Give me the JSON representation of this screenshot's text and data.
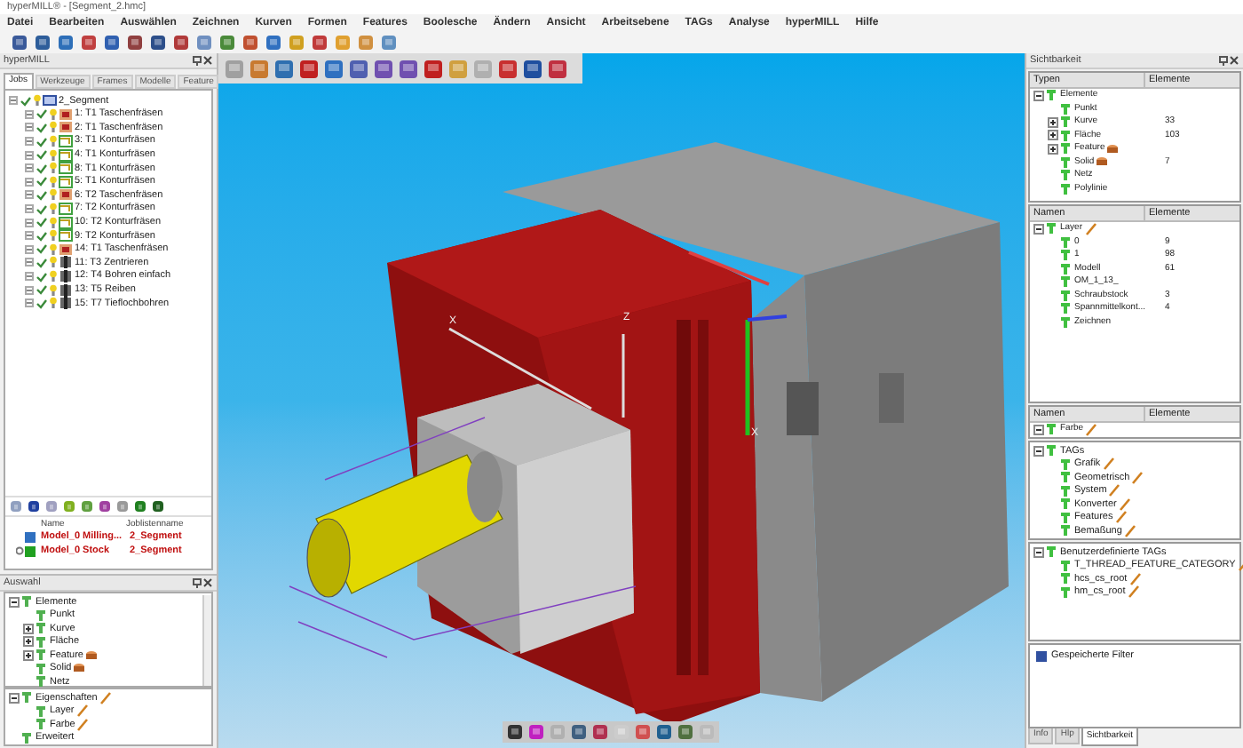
{
  "window": {
    "title": "hyperMILL® - [Segment_2.hmc]"
  },
  "menu": [
    "Datei",
    "Bearbeiten",
    "Auswählen",
    "Zeichnen",
    "Kurven",
    "Formen",
    "Features",
    "Boolesche",
    "Ändern",
    "Ansicht",
    "Arbeitsebene",
    "TAGs",
    "Analyse",
    "hyperMILL",
    "Hilfe"
  ],
  "jobs_panel": {
    "title": "hyperMILL",
    "tabs": [
      {
        "label": "Jobs",
        "selected": true
      },
      {
        "label": "Werkzeuge",
        "selected": false
      },
      {
        "label": "Frames",
        "selected": false
      },
      {
        "label": "Modelle",
        "selected": false
      },
      {
        "label": "Feature",
        "selected": false
      }
    ],
    "tree": [
      {
        "label": "2_Segment",
        "kind": "folder",
        "checked": true,
        "children": [
          {
            "label": "1: T1 Taschenfräsen",
            "kind": "pocket",
            "checked": true
          },
          {
            "label": "2: T1 Taschenfräsen",
            "kind": "pocket",
            "checked": true
          },
          {
            "label": "3: T1 Konturfräsen",
            "kind": "contour",
            "checked": true
          },
          {
            "label": "4: T1 Konturfräsen",
            "kind": "contour",
            "checked": true
          },
          {
            "label": "8: T1 Konturfräsen",
            "kind": "contour",
            "checked": true
          },
          {
            "label": "5: T1 Konturfräsen",
            "kind": "contour",
            "checked": true
          },
          {
            "label": "6: T2 Taschenfräsen",
            "kind": "pocket",
            "checked": true
          },
          {
            "label": "7: T2 Konturfräsen",
            "kind": "contour",
            "checked": true
          },
          {
            "label": "10: T2 Konturfräsen",
            "kind": "contour",
            "checked": true
          },
          {
            "label": "9: T2 Konturfräsen",
            "kind": "contour",
            "checked": true
          },
          {
            "label": "14: T1 Taschenfräsen",
            "kind": "pocket",
            "checked": true
          },
          {
            "label": "11: T3 Zentrieren",
            "kind": "drill",
            "checked": true
          },
          {
            "label": "12: T4 Bohren einfach",
            "kind": "drill",
            "checked": true
          },
          {
            "label": "13: T5 Reiben",
            "kind": "drill",
            "checked": true
          },
          {
            "label": "15: T7 Tieflochbohren",
            "kind": "drill",
            "checked": true
          }
        ]
      }
    ],
    "model_table": {
      "columns": [
        "Name",
        "Joblistenname"
      ],
      "rows": [
        {
          "kind": "milling",
          "name": "Model_0 Milling...",
          "joblist": "2_Segment"
        },
        {
          "kind": "stock",
          "name": "Model_0 Stock",
          "joblist": "2_Segment"
        }
      ]
    }
  },
  "selection_panel": {
    "title": "Auswahl",
    "tree": [
      {
        "label": "Elemente",
        "kind": "plain",
        "expanded": true,
        "children": [
          {
            "label": "Punkt",
            "kind": "plain"
          },
          {
            "label": "Kurve",
            "kind": "plain",
            "expanded": false
          },
          {
            "label": "Fläche",
            "kind": "plain",
            "expanded": false
          },
          {
            "label": "Feature",
            "kind": "solid",
            "expanded": false
          },
          {
            "label": "Solid",
            "kind": "solid"
          },
          {
            "label": "Netz",
            "kind": "plain"
          }
        ]
      }
    ],
    "properties": [
      {
        "label": "Eigenschaften",
        "kind": "tagged",
        "expanded": true,
        "children": [
          {
            "label": "Layer",
            "kind": "tagged"
          },
          {
            "label": "Farbe",
            "kind": "tagged"
          }
        ]
      },
      {
        "label": "Erweitert",
        "kind": "plain"
      }
    ]
  },
  "visibility_panel": {
    "title": "Sichtbarkeit",
    "types": {
      "columns": [
        "Typen",
        "Elemente"
      ],
      "tree": [
        {
          "label": "Elemente",
          "kind": "plain",
          "expanded": true,
          "children": [
            {
              "label": "Punkt",
              "kind": "plain"
            },
            {
              "label": "Kurve",
              "kind": "plain",
              "expanded": false,
              "value": "33"
            },
            {
              "label": "Fläche",
              "kind": "plain",
              "expanded": false,
              "value": "103"
            },
            {
              "label": "Feature",
              "kind": "solid",
              "expanded": false
            },
            {
              "label": "Solid",
              "kind": "solid",
              "value": "7"
            },
            {
              "label": "Netz",
              "kind": "plain"
            },
            {
              "label": "Polylinie",
              "kind": "plain"
            }
          ]
        }
      ]
    },
    "layers": {
      "columns": [
        "Namen",
        "Elemente"
      ],
      "tree": [
        {
          "label": "Layer",
          "kind": "tagged",
          "expanded": true,
          "children": [
            {
              "label": "0",
              "kind": "plain",
              "value": "9"
            },
            {
              "label": "1",
              "kind": "plain",
              "value": "98"
            },
            {
              "label": "Modell",
              "kind": "plain",
              "value": "61"
            },
            {
              "label": "OM_1_13_",
              "kind": "plain"
            },
            {
              "label": "Schraubstock",
              "kind": "plain",
              "value": "3"
            },
            {
              "label": "Spannmittelkont...",
              "kind": "plain",
              "value": "4"
            },
            {
              "label": "Zeichnen",
              "kind": "plain"
            }
          ]
        }
      ]
    },
    "colors": {
      "columns": [
        "Namen",
        "Elemente"
      ],
      "tree": [
        {
          "label": "Farbe",
          "kind": "tagged",
          "expanded": true
        }
      ]
    },
    "tags": [
      {
        "label": "TAGs",
        "kind": "plain",
        "expanded": true,
        "children": [
          {
            "label": "Grafik",
            "kind": "tagged"
          },
          {
            "label": "Geometrisch",
            "kind": "tagged"
          },
          {
            "label": "System",
            "kind": "tagged"
          },
          {
            "label": "Konverter",
            "kind": "tagged"
          },
          {
            "label": "Features",
            "kind": "tagged"
          },
          {
            "label": "Bemaßung",
            "kind": "tagged"
          }
        ]
      }
    ],
    "custom_tags": [
      {
        "label": "Benutzerdefinierte TAGs",
        "kind": "plain",
        "expanded": true,
        "children": [
          {
            "label": "T_THREAD_FEATURE_CATEGORY",
            "kind": "tagged"
          },
          {
            "label": "hcs_cs_root",
            "kind": "tagged"
          },
          {
            "label": "hm_cs_root",
            "kind": "tagged"
          }
        ]
      }
    ],
    "saved_filters": {
      "label": "Gespeicherte Filter"
    },
    "tabs": [
      {
        "label": "Info",
        "selected": false
      },
      {
        "label": "Hlp",
        "selected": false
      },
      {
        "label": "Sichtbarkeit",
        "selected": true
      }
    ]
  },
  "viewport": {
    "axis_labels": [
      "X",
      "Z",
      "X"
    ]
  }
}
